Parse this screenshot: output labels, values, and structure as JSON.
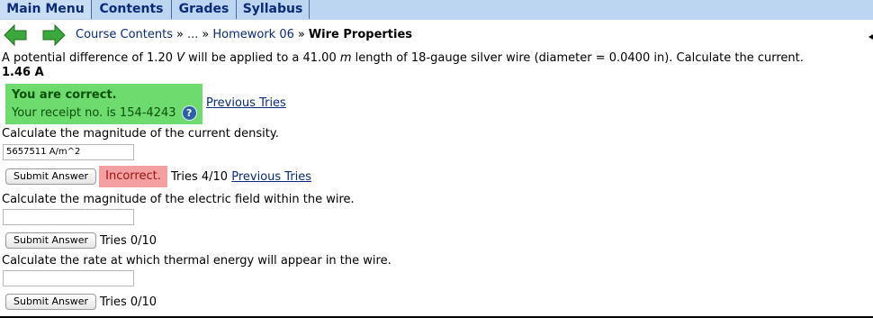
{
  "menu": {
    "items": [
      "Main Menu",
      "Contents",
      "Grades",
      "Syllabus"
    ]
  },
  "nav": {
    "back_icon": "back-arrow-icon",
    "forward_icon": "forward-arrow-icon",
    "course_contents": "Course Contents",
    "sep": "»",
    "ellipsis": "...",
    "homework": "Homework 06",
    "current": "Wire Properties",
    "arrow_color": "#3aa83a"
  },
  "problem": {
    "statement_prefix": "A potential difference of 1.20 ",
    "unit_v": "V",
    "statement_mid": " will be applied to a 41.00 ",
    "unit_m": "m",
    "statement_suffix": " length of 18-gauge silver wire (diameter = 0.0400 in). Calculate the current.",
    "answer1": "1.46 A",
    "correct_title": "You are correct.",
    "receipt": "Your receipt no. is 154-4243",
    "help_icon": "?",
    "previous_tries_1": "Previous Tries",
    "q2": "Calculate the magnitude of the current density.",
    "q2_value": "5657511 A/m^2",
    "submit_label": "Submit Answer",
    "incorrect_label": "Incorrect.",
    "q2_tries": "Tries 4/10",
    "previous_tries_2": "Previous Tries",
    "q3": "Calculate the magnitude of the electric field within the wire.",
    "q3_value": "",
    "q3_tries": "Tries 0/10",
    "q4": "Calculate the rate at which thermal energy will appear in the wire.",
    "q4_value": "",
    "q4_tries": "Tries 0/10"
  },
  "colors": {
    "menubar": "#bcd5f1",
    "correct_bg": "#6ddb6d",
    "incorrect_bg": "#f4a0a0",
    "link": "#0a2a7a"
  }
}
